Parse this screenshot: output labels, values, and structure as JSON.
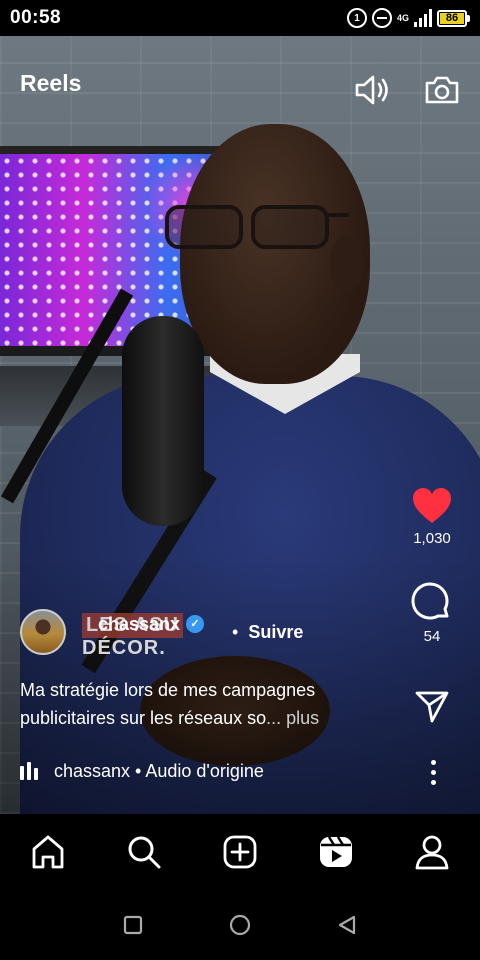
{
  "status_bar": {
    "time": "00:58",
    "network_label": "4G",
    "battery_level": "86",
    "battery_color": "#e8d21a"
  },
  "header": {
    "title": "Reels",
    "icons": [
      "speaker-icon",
      "camera-icon"
    ]
  },
  "reel": {
    "owner": {
      "username": "chassanx",
      "verified": true,
      "overlay_text_line1": "LES ASU",
      "overlay_text_line2": "DÉCOR.",
      "separator": "•",
      "follow_label": "Suivre"
    },
    "caption": {
      "text": "Ma stratégie lors de mes campagnes publicitaires sur les réseaux so",
      "ellipsis": "...",
      "more_label": " plus"
    },
    "audio": {
      "label": "chassanx • Audio d'origine"
    },
    "actions": {
      "like": {
        "count": "1,030",
        "liked": true,
        "color": "#ff3040"
      },
      "comment": {
        "count": "54"
      },
      "share": {},
      "more": {}
    }
  },
  "bottom_nav": {
    "items": [
      "home-icon",
      "search-icon",
      "create-icon",
      "reels-icon",
      "profile-icon"
    ],
    "active": "reels-icon"
  },
  "system_nav": {
    "buttons": [
      "recents-button",
      "home-button",
      "back-button"
    ]
  }
}
